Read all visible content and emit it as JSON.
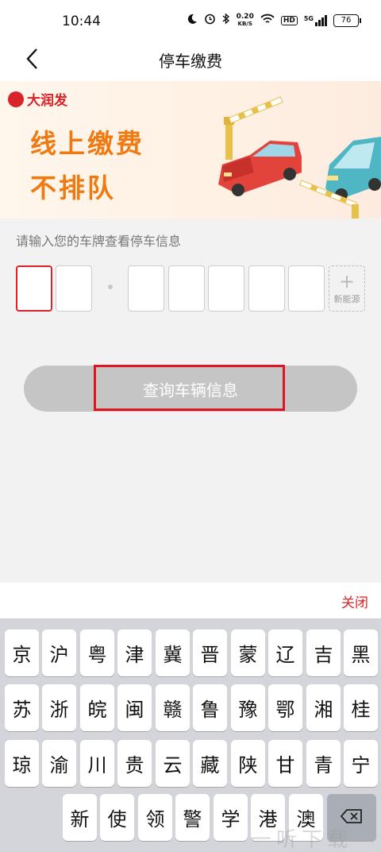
{
  "status_bar": {
    "time": "10:44",
    "speed_value": "0.20",
    "speed_unit": "KB/S",
    "hd": "HD",
    "network": "5G",
    "battery": "76"
  },
  "nav": {
    "title": "停车缴费"
  },
  "banner": {
    "brand": "大润发",
    "slogan_line1": "线上缴费",
    "slogan_line2": "不排队"
  },
  "form": {
    "hint": "请输入您的车牌查看停车信息",
    "new_energy_label": "新能源",
    "plus": "+"
  },
  "query_button": {
    "label": "查询车辆信息"
  },
  "keyboard": {
    "close_label": "关闭",
    "rows": [
      [
        "京",
        "沪",
        "粤",
        "津",
        "冀",
        "晋",
        "蒙",
        "辽",
        "吉",
        "黑"
      ],
      [
        "苏",
        "浙",
        "皖",
        "闽",
        "赣",
        "鲁",
        "豫",
        "鄂",
        "湘",
        "桂"
      ],
      [
        "琼",
        "渝",
        "川",
        "贵",
        "云",
        "藏",
        "陕",
        "甘",
        "青",
        "宁"
      ],
      [
        "新",
        "使",
        "领",
        "警",
        "学",
        "港",
        "澳"
      ]
    ]
  },
  "colors": {
    "brand_red": "#d8232a",
    "slogan_orange": "#f07a12",
    "button_disabled": "#c5c5c5",
    "highlight_red": "#e0141e"
  },
  "icons": [
    "back-icon",
    "moon-icon",
    "alarm-icon",
    "bluetooth-icon",
    "wifi-icon",
    "signal-icon",
    "battery-icon",
    "delete-icon"
  ],
  "watermark": "一听下载"
}
